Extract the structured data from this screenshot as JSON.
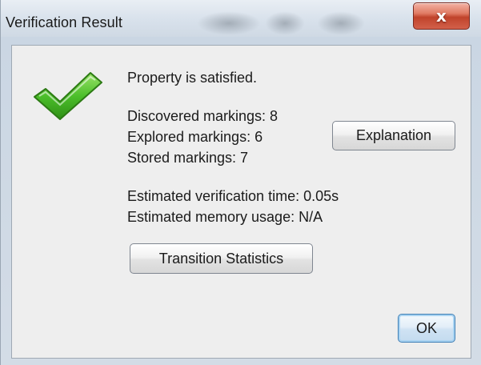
{
  "window": {
    "title": "Verification Result",
    "close_label": "x"
  },
  "result": {
    "status": "Property is satisfied.",
    "discovered": "Discovered markings: 8",
    "explored": "Explored markings: 6",
    "stored": "Stored markings: 7",
    "time": "Estimated verification time: 0.05s",
    "memory": "Estimated memory usage: N/A"
  },
  "buttons": {
    "explanation": "Explanation",
    "transition_statistics": "Transition Statistics",
    "ok": "OK"
  },
  "icons": {
    "success": "green-checkmark-icon"
  },
  "colors": {
    "check_green": "#4cbf2a",
    "close_red": "#c8472f",
    "ok_focus": "#3f7fb5"
  }
}
